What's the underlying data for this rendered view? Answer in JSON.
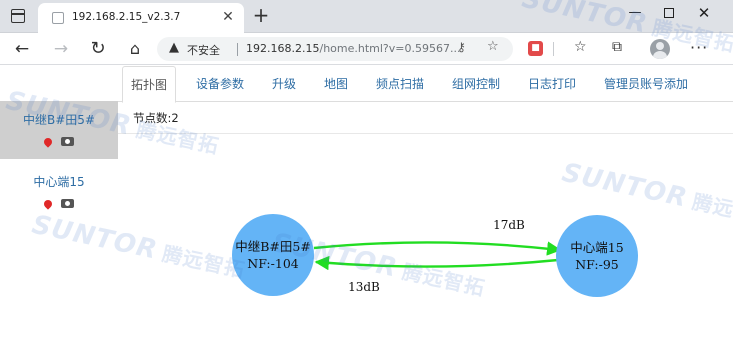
{
  "browser": {
    "tab_title": "192.168.2.15_v2.3.7",
    "new_tab": "+",
    "tab_close": "✕",
    "window_controls": {
      "minimize": "—",
      "close": "✕"
    },
    "security_label": "不安全",
    "url_host": "192.168.2.15",
    "url_rest": "/home.html?v=0.59567...",
    "icons": [
      "window-icon",
      "back-icon",
      "forward-icon",
      "reload-icon",
      "home-icon",
      "warning-icon",
      "key-icon",
      "add-favorite-icon",
      "extension-icon",
      "favorites-icon",
      "collections-icon",
      "profile-icon",
      "menu-icon"
    ]
  },
  "nav_tabs": [
    {
      "label": "拓扑图",
      "active": true
    },
    {
      "label": "设备参数",
      "active": false
    },
    {
      "label": "升级",
      "active": false
    },
    {
      "label": "地图",
      "active": false
    },
    {
      "label": "频点扫描",
      "active": false
    },
    {
      "label": "组网控制",
      "active": false
    },
    {
      "label": "日志打印",
      "active": false
    },
    {
      "label": "管理员账号添加",
      "active": false
    }
  ],
  "sidebar": {
    "nodes": [
      {
        "name": "中继B#田5#",
        "selected": true
      },
      {
        "name": "中心端15",
        "selected": false
      }
    ]
  },
  "node_count": "节点数:2",
  "topology": {
    "nodes": [
      {
        "name": "中继B#田5#",
        "nf": "NF:-104"
      },
      {
        "name": "中心端15",
        "nf": "NF:-95"
      }
    ],
    "links": [
      {
        "label": "17dB",
        "direction": "to-right"
      },
      {
        "label": "13dB",
        "direction": "to-left"
      }
    ],
    "node_color": "#64b4f6",
    "link_color": "#22dd22"
  },
  "watermark": {
    "brand": "SUNTOR",
    "cn": "腾远智拓"
  }
}
